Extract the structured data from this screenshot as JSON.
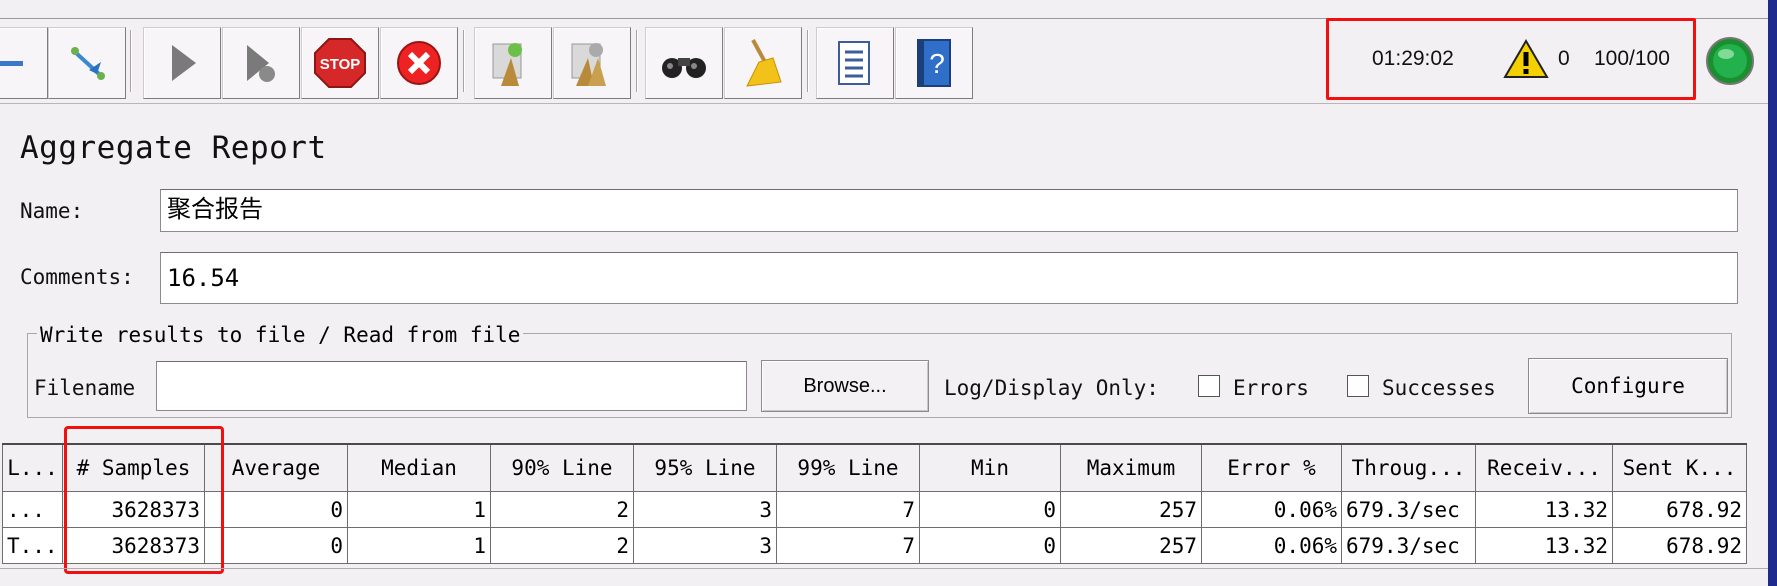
{
  "toolbar": {
    "buttons": [
      {
        "icon": "minus-icon"
      },
      {
        "icon": "toggle-icon"
      },
      {
        "icon": "start-icon"
      },
      {
        "icon": "start-no-pauses-icon"
      },
      {
        "icon": "stop-icon",
        "label": "STOP"
      },
      {
        "icon": "shutdown-icon"
      },
      {
        "icon": "clear-icon"
      },
      {
        "icon": "clear-all-icon"
      },
      {
        "icon": "search-icon"
      },
      {
        "icon": "reset-search-icon"
      },
      {
        "icon": "function-helper-icon"
      },
      {
        "icon": "help-icon",
        "label": "?"
      }
    ]
  },
  "status": {
    "elapsed": "01:29:02",
    "warning_count": "0",
    "threads": "100/100",
    "indicator_color": "#22b14c"
  },
  "panel": {
    "title": "Aggregate Report",
    "name_label": "Name:",
    "name_value": "聚合报告",
    "comments_label": "Comments:",
    "comments_value": "16.54"
  },
  "file_group": {
    "legend": "Write results to file / Read from file",
    "filename_label": "Filename",
    "filename_value": "",
    "browse_label": "Browse...",
    "log_display_label": "Log/Display Only:",
    "errors_label": "Errors",
    "successes_label": "Successes",
    "configure_label": "Configure"
  },
  "table": {
    "headers": [
      "L...",
      "# Samples",
      "Average",
      "Median",
      "90% Line",
      "95% Line",
      "99% Line",
      "Min",
      "Maximum",
      "Error %",
      "Throug...",
      "Receiv...",
      "Sent K..."
    ],
    "rows": [
      [
        "...",
        "3628373",
        "0",
        "1",
        "2",
        "3",
        "7",
        "0",
        "257",
        "0.06%",
        "679.3/sec",
        "13.32",
        "678.92"
      ],
      [
        "T...",
        "3628373",
        "0",
        "1",
        "2",
        "3",
        "7",
        "0",
        "257",
        "0.06%",
        "679.3/sec",
        "13.32",
        "678.92"
      ]
    ]
  },
  "colors": {
    "highlight": "#f20f0f",
    "warning": "#f5d000"
  }
}
